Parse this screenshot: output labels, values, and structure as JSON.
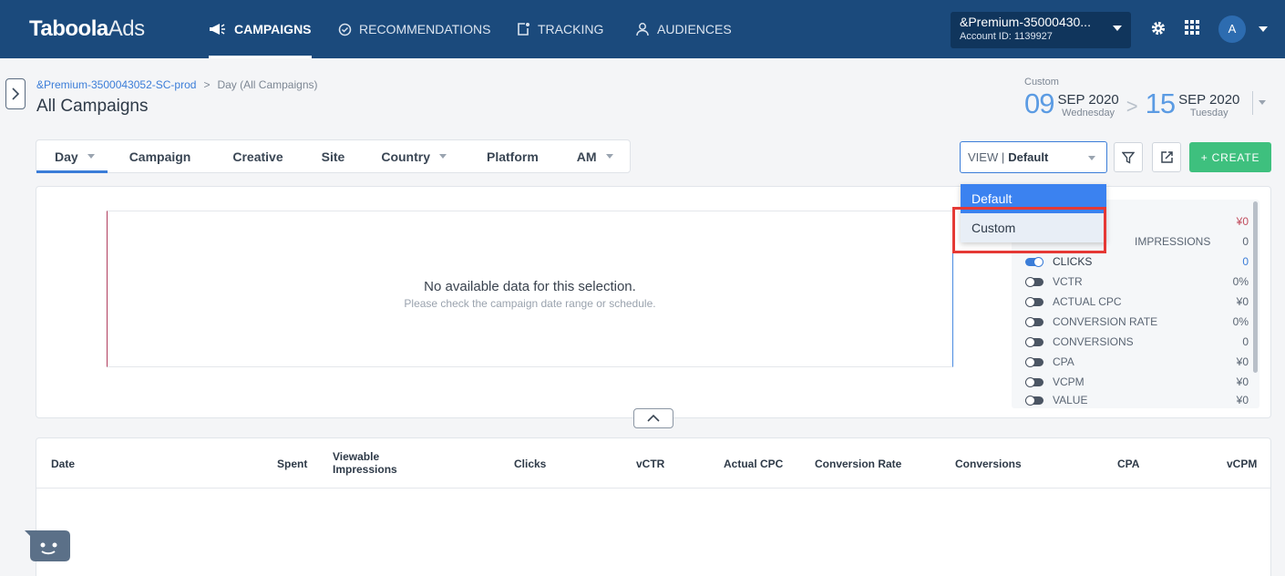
{
  "header": {
    "logo_text": "Taboola",
    "logo_suffix": "Ads",
    "nav": [
      {
        "label": "CAMPAIGNS",
        "icon": "megaphone-icon"
      },
      {
        "label": "RECOMMENDATIONS",
        "icon": "check-circle-icon"
      },
      {
        "label": "TRACKING",
        "icon": "tracking-icon"
      },
      {
        "label": "AUDIENCES",
        "icon": "person-icon"
      }
    ],
    "account_name": "&Premium-35000430...",
    "account_id": "Account ID: 1139927",
    "avatar_letter": "A"
  },
  "breadcrumb": {
    "account": "&Premium-3500043052-SC-prod",
    "separator": ">",
    "current": "Day (All Campaigns)"
  },
  "page_title": "All Campaigns",
  "date_range": {
    "label": "Custom",
    "start_day": "09",
    "start_month": "SEP 2020",
    "start_weekday": "Wednesday",
    "separator": ">",
    "end_day": "15",
    "end_month": "SEP 2020",
    "end_weekday": "Tuesday"
  },
  "tabs": [
    {
      "label": "Day",
      "dropdown": true
    },
    {
      "label": "Campaign",
      "dropdown": false
    },
    {
      "label": "Creative",
      "dropdown": false
    },
    {
      "label": "Site",
      "dropdown": false
    },
    {
      "label": "Country",
      "dropdown": true
    },
    {
      "label": "Platform",
      "dropdown": false
    },
    {
      "label": "AM",
      "dropdown": true
    }
  ],
  "view": {
    "prefix": "VIEW |",
    "value": "Default",
    "options": [
      "Default",
      "Custom"
    ]
  },
  "create_label": "+ CREATE",
  "graph": {
    "empty_title": "No available data for this selection.",
    "empty_sub": "Please check the campaign date range or schedule."
  },
  "metrics": [
    {
      "label": "",
      "value": "¥0",
      "on": false
    },
    {
      "label": "IMPRESSIONS",
      "value": "0",
      "on": false
    },
    {
      "label": "CLICKS",
      "value": "0",
      "on": true
    },
    {
      "label": "VCTR",
      "value": "0%",
      "on": false
    },
    {
      "label": "ACTUAL CPC",
      "value": "¥0",
      "on": false
    },
    {
      "label": "CONVERSION RATE",
      "value": "0%",
      "on": false
    },
    {
      "label": "CONVERSIONS",
      "value": "0",
      "on": false
    },
    {
      "label": "CPA",
      "value": "¥0",
      "on": false
    },
    {
      "label": "VCPM",
      "value": "¥0",
      "on": false
    },
    {
      "label": "VALUE",
      "value": "¥0",
      "on": false
    }
  ],
  "table": {
    "columns": [
      "Date",
      "Spent",
      "Viewable Impressions",
      "Clicks",
      "vCTR",
      "Actual CPC",
      "Conversion Rate",
      "Conversions",
      "CPA",
      "vCPM"
    ]
  }
}
